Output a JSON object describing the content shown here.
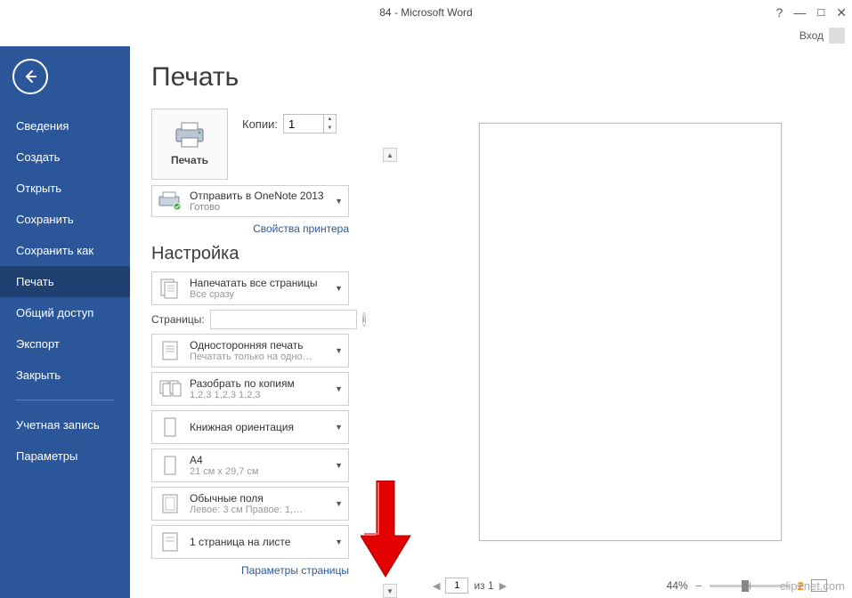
{
  "window": {
    "title": "84 - Microsoft Word",
    "signin": "Вход"
  },
  "sidebar": {
    "items": [
      {
        "label": "Сведения"
      },
      {
        "label": "Создать"
      },
      {
        "label": "Открыть"
      },
      {
        "label": "Сохранить"
      },
      {
        "label": "Сохранить как"
      },
      {
        "label": "Печать"
      },
      {
        "label": "Общий доступ"
      },
      {
        "label": "Экспорт"
      },
      {
        "label": "Закрыть"
      }
    ],
    "footer": [
      {
        "label": "Учетная запись"
      },
      {
        "label": "Параметры"
      }
    ]
  },
  "print": {
    "title": "Печать",
    "button": "Печать",
    "copies_label": "Копии:",
    "copies_value": "1",
    "printer": {
      "name": "Отправить в OneNote 2013",
      "status": "Готово"
    },
    "printer_props": "Свойства принтера",
    "settings_title": "Настройка",
    "settings": {
      "print_all": {
        "line1": "Напечатать все страницы",
        "line2": "Все сразу"
      },
      "pages_label": "Страницы:",
      "pages_value": "",
      "sides": {
        "line1": "Односторонняя печать",
        "line2": "Печатать только на одно…"
      },
      "collate": {
        "line1": "Разобрать по копиям",
        "line2": "1,2,3   1,2,3   1,2,3"
      },
      "orientation": {
        "line1": "Книжная ориентация"
      },
      "size": {
        "line1": "A4",
        "line2": "21 см x 29,7 см"
      },
      "margins": {
        "line1": "Обычные поля",
        "line2": "Левое: 3 см   Правое: 1,…"
      },
      "per_sheet": {
        "line1": "1 страница на листе"
      }
    },
    "page_setup": "Параметры страницы"
  },
  "status": {
    "page_current": "1",
    "page_of": "из 1",
    "zoom": "44%"
  },
  "watermark": {
    "p1": "clip",
    "p2": "2",
    "p3": "net",
    "p4": ".com"
  }
}
